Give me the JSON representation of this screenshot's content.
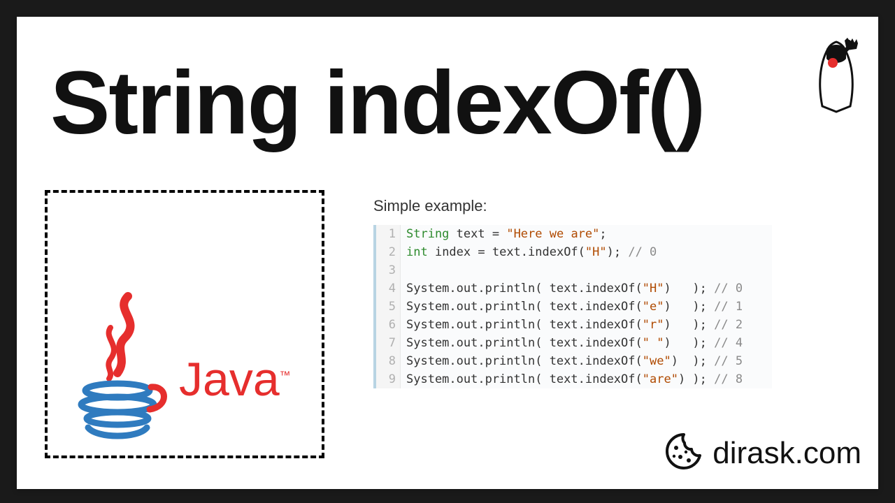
{
  "title": "String indexOf()",
  "example_caption": "Simple example:",
  "java_word": "Java",
  "java_tm": "™",
  "brand": "dirask.com",
  "code": {
    "lines": [
      {
        "n": 1,
        "tokens": [
          {
            "t": "String ",
            "c": "tok-type"
          },
          {
            "t": "text ",
            "c": "tok-var"
          },
          {
            "t": "= ",
            "c": "tok-op"
          },
          {
            "t": "\"Here we are\"",
            "c": "tok-str"
          },
          {
            "t": ";",
            "c": "tok-op"
          }
        ]
      },
      {
        "n": 2,
        "tokens": [
          {
            "t": "int ",
            "c": "tok-type"
          },
          {
            "t": "index ",
            "c": "tok-var"
          },
          {
            "t": "= text.indexOf(",
            "c": "tok-op"
          },
          {
            "t": "\"H\"",
            "c": "tok-str"
          },
          {
            "t": "); ",
            "c": "tok-op"
          },
          {
            "t": "// 0",
            "c": "tok-comm"
          }
        ]
      },
      {
        "n": 3,
        "tokens": [
          {
            "t": "",
            "c": ""
          }
        ]
      },
      {
        "n": 4,
        "tokens": [
          {
            "t": "System.out.println( text.indexOf(",
            "c": "tok-var"
          },
          {
            "t": "\"H\"",
            "c": "tok-str"
          },
          {
            "t": ")   ); ",
            "c": "tok-op"
          },
          {
            "t": "// 0",
            "c": "tok-comm"
          }
        ]
      },
      {
        "n": 5,
        "tokens": [
          {
            "t": "System.out.println( text.indexOf(",
            "c": "tok-var"
          },
          {
            "t": "\"e\"",
            "c": "tok-str"
          },
          {
            "t": ")   ); ",
            "c": "tok-op"
          },
          {
            "t": "// 1",
            "c": "tok-comm"
          }
        ]
      },
      {
        "n": 6,
        "tokens": [
          {
            "t": "System.out.println( text.indexOf(",
            "c": "tok-var"
          },
          {
            "t": "\"r\"",
            "c": "tok-str"
          },
          {
            "t": ")   ); ",
            "c": "tok-op"
          },
          {
            "t": "// 2",
            "c": "tok-comm"
          }
        ]
      },
      {
        "n": 7,
        "tokens": [
          {
            "t": "System.out.println( text.indexOf(",
            "c": "tok-var"
          },
          {
            "t": "\" \"",
            "c": "tok-str"
          },
          {
            "t": ")   ); ",
            "c": "tok-op"
          },
          {
            "t": "// 4",
            "c": "tok-comm"
          }
        ]
      },
      {
        "n": 8,
        "tokens": [
          {
            "t": "System.out.println( text.indexOf(",
            "c": "tok-var"
          },
          {
            "t": "\"we\"",
            "c": "tok-str"
          },
          {
            "t": ")  ); ",
            "c": "tok-op"
          },
          {
            "t": "// 5",
            "c": "tok-comm"
          }
        ]
      },
      {
        "n": 9,
        "tokens": [
          {
            "t": "System.out.println( text.indexOf(",
            "c": "tok-var"
          },
          {
            "t": "\"are\"",
            "c": "tok-str"
          },
          {
            "t": ") ); ",
            "c": "tok-op"
          },
          {
            "t": "// 8",
            "c": "tok-comm"
          }
        ]
      }
    ]
  }
}
